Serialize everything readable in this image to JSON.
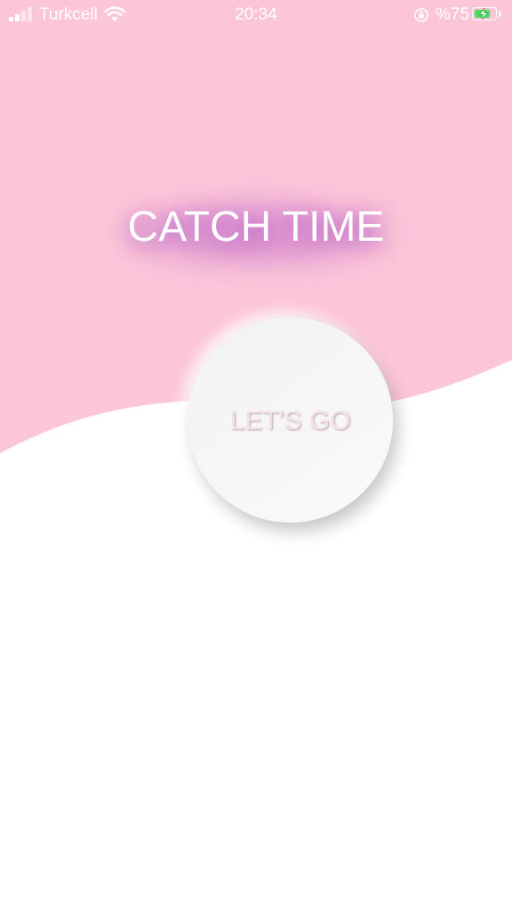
{
  "status_bar": {
    "carrier": "Turkcell",
    "time": "20:34",
    "battery_percent": "%75",
    "battery_level": 0.75,
    "icons": [
      "signal-icon",
      "wifi-icon",
      "rotation-lock-icon",
      "battery-icon",
      "charging-bolt-icon"
    ]
  },
  "main": {
    "title": "CATCH TIME",
    "go_button_label": "LET'S GO"
  },
  "colors": {
    "pink_background": "#fcc5d8",
    "white_background": "#ffffff",
    "title_glow": "#c070c8",
    "button_surface": "#f4f4f4",
    "battery_fill": "#4cd964"
  }
}
